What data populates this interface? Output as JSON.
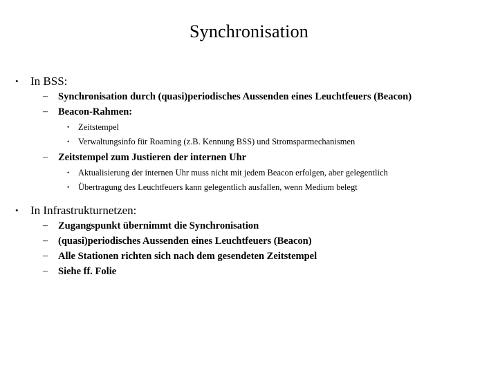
{
  "slide": {
    "title": "Synchronisation",
    "background_color": "#ffffff",
    "text_color": "#000000",
    "bullets": {
      "level1": "•",
      "level2": "–",
      "level3": "•"
    },
    "outline": [
      {
        "level": 1,
        "text": "In BSS:",
        "children": [
          {
            "level": 2,
            "text": "Synchronisation durch (quasi)periodisches Aussenden eines Leuchtfeuers (Beacon)",
            "children": []
          },
          {
            "level": 2,
            "text": "Beacon-Rahmen:",
            "children": [
              {
                "level": 3,
                "text": "Zeitstempel"
              },
              {
                "level": 3,
                "text": "Verwaltungsinfo für Roaming (z.B. Kennung BSS) und Stromsparmechanismen"
              }
            ]
          },
          {
            "level": 2,
            "text": "Zeitstempel zum Justieren der internen Uhr",
            "children": [
              {
                "level": 3,
                "text": "Aktualisierung der internen Uhr muss nicht mit jedem Beacon erfolgen, aber gelegentlich"
              },
              {
                "level": 3,
                "text": "Übertragung des Leuchtfeuers kann gelegentlich ausfallen, wenn Medium belegt"
              }
            ]
          }
        ]
      },
      {
        "level": 1,
        "text": "In Infrastrukturnetzen:",
        "children": [
          {
            "level": 2,
            "text": "Zugangspunkt übernimmt die Synchronisation",
            "children": []
          },
          {
            "level": 2,
            "text": "(quasi)periodisches Aussenden eines Leuchtfeuers (Beacon)",
            "children": []
          },
          {
            "level": 2,
            "text": "Alle Stationen richten sich nach dem gesendeten Zeitstempel",
            "children": []
          },
          {
            "level": 2,
            "text": "Siehe ff. Folie",
            "children": []
          }
        ]
      }
    ]
  }
}
